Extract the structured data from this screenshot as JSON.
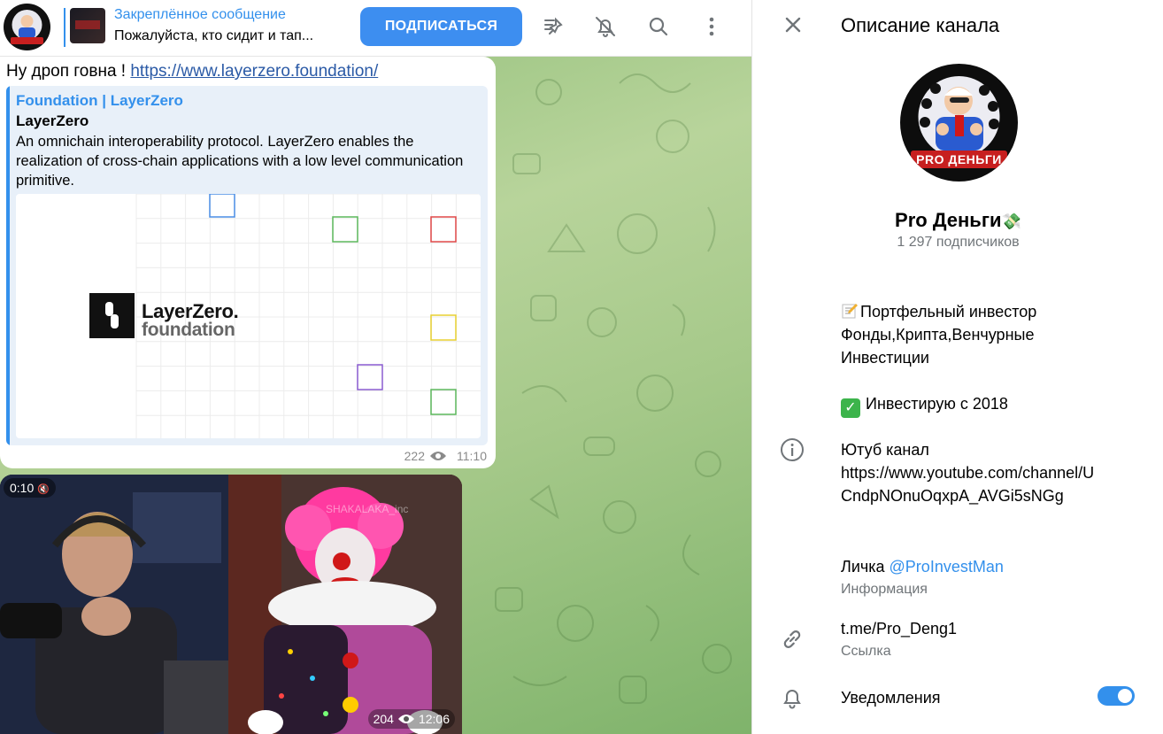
{
  "header": {
    "pinned_title": "Закреплённое сообщение",
    "pinned_text": "Пожалуйста, кто сидит и тап...",
    "subscribe_label": "ПОДПИСАТЬСЯ",
    "channel_avatar_text": "PRO ДЕНЬГИ"
  },
  "message1": {
    "text_prefix": "Ну дроп говна ! ",
    "link": "https://www.layerzero.foundation/",
    "preview": {
      "site": "Foundation | LayerZero",
      "title": "LayerZero",
      "description": "An omnichain interoperability protocol. LayerZero enables the realization of cross-chain applications with a low level communication primitive.",
      "logo_line1": "LayerZero.",
      "logo_line2": "foundation"
    },
    "views": "222",
    "time": "11:10"
  },
  "message2": {
    "duration": "0:10",
    "watermark": "SHAKALAKA_inc",
    "views": "204",
    "time": "12:06"
  },
  "panel": {
    "title": "Описание канала",
    "avatar_text": "PRO ДЕНЬГИ",
    "channel_name": "Pro Деньги",
    "subscribers": "1 297 подписчиков",
    "desc_line1": "Портфельный инвестор",
    "desc_line2": "Фонды,Крипта,Венчурные",
    "desc_line3": "Инвестиции",
    "desc_since": "Инвестирую с 2018",
    "youtube_label": "Ютуб канал",
    "youtube_url1": "https://www.youtube.com/channel/U",
    "youtube_url2": "CndpNOnuOqxpA_AVGi5sNGg",
    "contact_prefix": "Личка ",
    "contact_mention": "@ProInvestMan",
    "info_label": "Информация",
    "link": "t.me/Pro_Deng1",
    "link_label": "Ссылка",
    "notifications_label": "Уведомления",
    "notifications_on": true
  },
  "colors": {
    "accent": "#3390ec",
    "subscribe_bg": "#3d8ef0",
    "wallpaper": "#a6c98a"
  }
}
